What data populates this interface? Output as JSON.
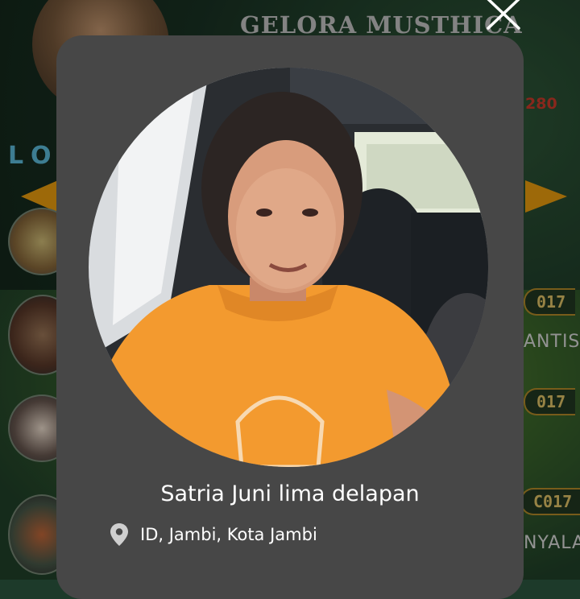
{
  "background": {
    "app_title": "GELORA MUSTHICA",
    "left_partial_text": "LO",
    "right_number": "280",
    "code_badges": [
      "017",
      "017",
      "C017"
    ],
    "side_texts": [
      "ANTIS",
      "NYALA"
    ]
  },
  "profile_modal": {
    "name": "Satria Juni lima delapan",
    "location": "ID, Jambi, Kota Jambi",
    "location_icon": "map-pin-icon",
    "close_icon": "close-icon",
    "photo": "profile-photo"
  },
  "colors": {
    "modal_bg": "#474747",
    "accent_orange": "#f1a10f",
    "badge_gold": "#e9c96a"
  }
}
